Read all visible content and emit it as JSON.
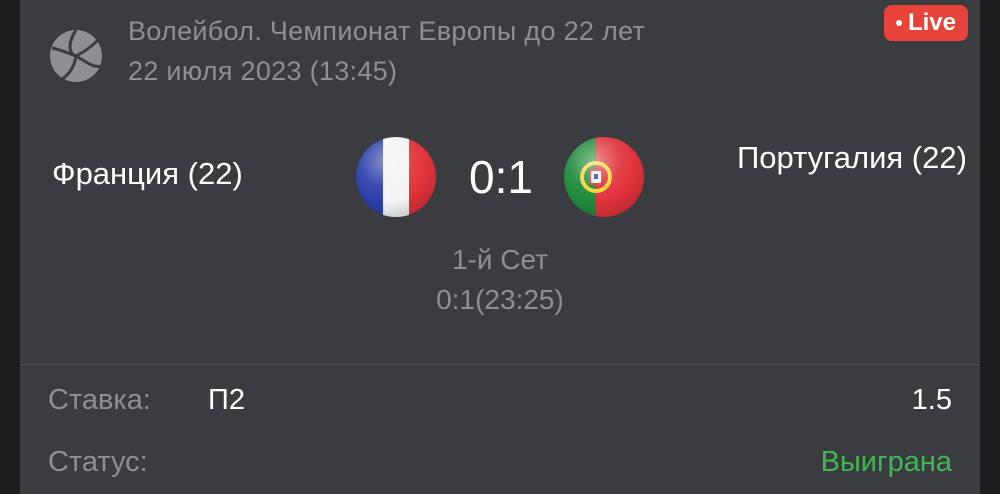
{
  "header": {
    "league": "Волейбол. Чемпионат Европы до 22 лет",
    "datetime": "22 июля 2023 (13:45)",
    "live_label": "Live",
    "sport_icon": "volleyball-icon"
  },
  "match": {
    "home_team": "Франция (22)",
    "away_team": "Португалия (22)",
    "score": "0:1",
    "period": "1-й Сет",
    "period_score": "0:1(23:25)",
    "home_flag": "france-flag-icon",
    "away_flag": "portugal-flag-icon"
  },
  "bet": {
    "label": "Ставка:",
    "value": "П2",
    "odds": "1.5"
  },
  "status": {
    "label": "Статус:",
    "value": "Выиграна"
  },
  "colors": {
    "card_bg": "#3a3c3f",
    "live_badge": "#e8433a",
    "win_status": "#3fb652",
    "muted_text": "#8c8f93"
  }
}
